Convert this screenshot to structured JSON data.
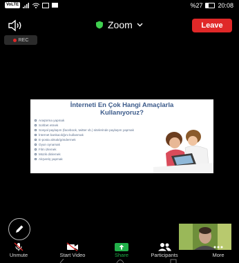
{
  "status_bar": {
    "network_label": "VoLTE",
    "battery": "%27",
    "time": "20:08",
    "battery_level": 0.27
  },
  "header": {
    "app_title": "Zoom",
    "leave_label": "Leave",
    "rec_label": "REC"
  },
  "shared_slide": {
    "title_line1": "İnterneti En Çok Hangi Amaçlarla",
    "title_line2": "Kullanıyoruz?",
    "items": [
      "Araştırma yapmak",
      "Sohbet etmek",
      "Sosyal paylaşım (facebook, twitter vb.) sitelerinde paylaşım yapmak",
      "İnternet bankacılığını kullanmak",
      "E-posta almak/göndermek",
      "Oyun oynamak",
      "Film izlemek",
      "Müzik dinlemek",
      "Alışveriş yapmak"
    ]
  },
  "toolbar": {
    "unmute": "Unmute",
    "start_video": "Start Video",
    "share": "Share",
    "participants": "Participants",
    "more": "More"
  },
  "colors": {
    "leave": "#e02828",
    "share": "#22b04a",
    "shield": "#3fcf4f"
  }
}
